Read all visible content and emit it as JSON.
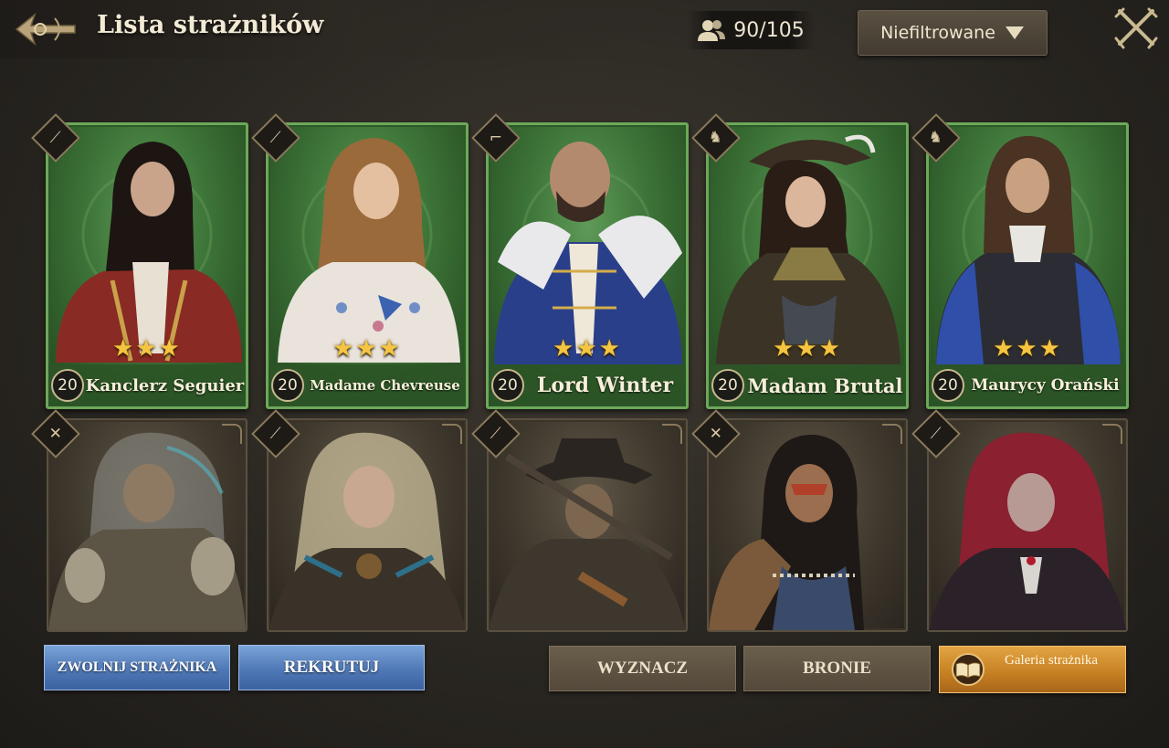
{
  "header": {
    "title": "Lista strażników",
    "back_icon": "ornate-back-arrow-icon",
    "counter": "90/105",
    "counter_icon": "users-icon",
    "filter_label": "Niefiltrowane",
    "close_icon": "crossed-swords-close-icon"
  },
  "unlocked_guardians": [
    {
      "name": "Kanclerz Seguier",
      "level": "20",
      "stars": "★★★",
      "class_icon": "spear-icon"
    },
    {
      "name": "Madame Chevreuse",
      "level": "20",
      "stars": "★★★",
      "class_icon": "spear-icon"
    },
    {
      "name": "Lord Winter",
      "level": "20",
      "stars": "★★★",
      "class_icon": "pistol-icon"
    },
    {
      "name": "Madam Brutal",
      "level": "20",
      "stars": "★★★",
      "class_icon": "horse-icon"
    },
    {
      "name": "Maurycy Orański",
      "level": "20",
      "stars": "★★★",
      "class_icon": "horse-icon"
    }
  ],
  "locked_guardians": [
    {
      "class_icon": "crossed-spears-icon"
    },
    {
      "class_icon": "musket-icon"
    },
    {
      "class_icon": "musket-icon"
    },
    {
      "class_icon": "crossed-spears-icon"
    },
    {
      "class_icon": "musket-icon"
    }
  ],
  "buttons": {
    "dismiss": "ZWOLNIJ STRAŻNIKA",
    "recruit": "REKRUTUJ",
    "assign": "WYZNACZ",
    "weapons": "BRONIE",
    "gallery": "Galeria strażnika",
    "gallery_icon": "open-book-icon"
  },
  "colors": {
    "unlocked_card": "#3c7337",
    "locked_card": "#3f382d",
    "star": "#f5c542",
    "blue_button": "#4f78b6",
    "orange_button": "#c47f22"
  }
}
